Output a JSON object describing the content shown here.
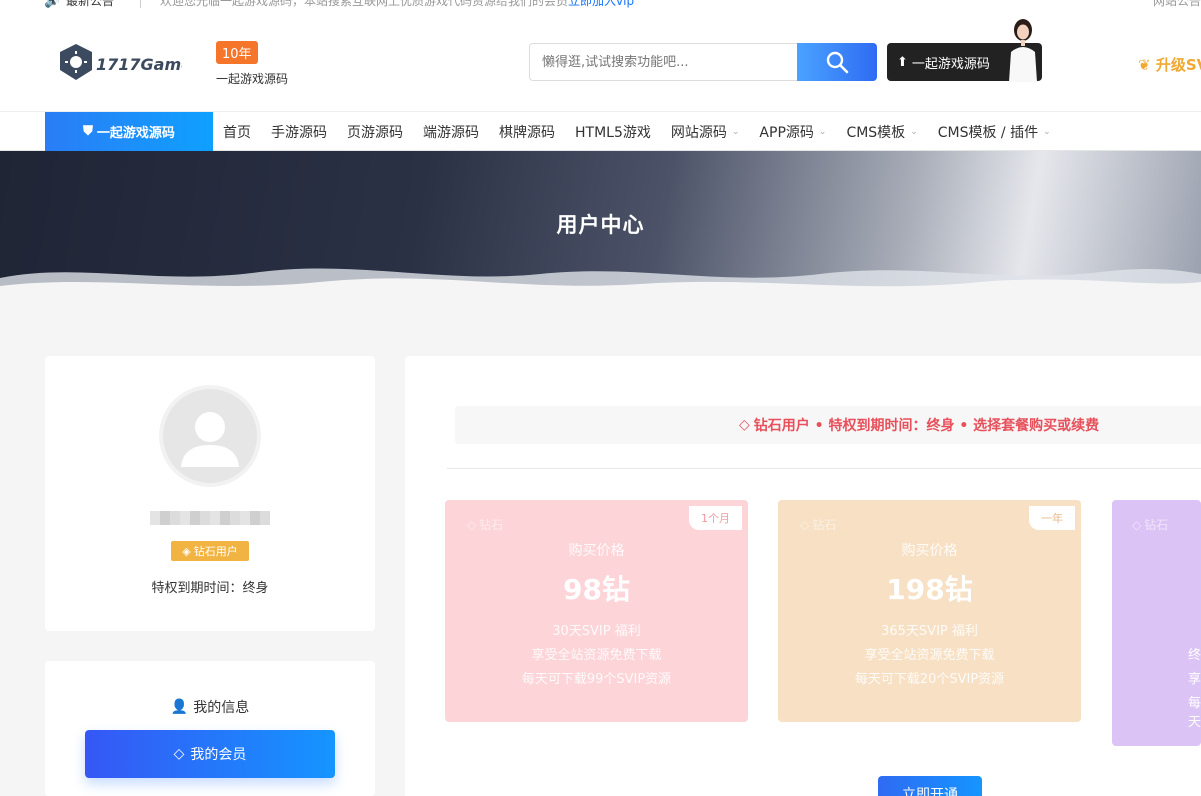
{
  "topbar": {
    "label": "最新公告",
    "message": "欢迎您光临一起游戏源码，本站搜索互联网上优质游戏代码资源给我们的会员",
    "link": "立即加入vip",
    "right": "网站公告"
  },
  "header": {
    "logo_text": "1717Game",
    "year_badge": "10年",
    "site_sub": "一起游戏源码",
    "search_placeholder": "懒得逛,试试搜索功能吧...",
    "dark_button": "一起游戏源码",
    "upgrade": "升级SVIP"
  },
  "nav": {
    "brand": "一起游戏源码",
    "items": [
      {
        "label": "首页",
        "caret": ""
      },
      {
        "label": "手游源码",
        "caret": ""
      },
      {
        "label": "页游源码",
        "caret": ""
      },
      {
        "label": "端游源码",
        "caret": ""
      },
      {
        "label": "棋牌源码",
        "caret": ""
      },
      {
        "label": "HTML5游戏",
        "caret": ""
      },
      {
        "label": "网站源码",
        "caret": "⌄"
      },
      {
        "label": "APP源码",
        "caret": "⌄"
      },
      {
        "label": "CMS模板",
        "caret": "⌄"
      },
      {
        "label": "CMS模板 / 插件",
        "caret": "⌄"
      }
    ]
  },
  "banner": {
    "title": "用户中心"
  },
  "profile": {
    "badge": "钻石用户",
    "expire": "特权到期时间：终身"
  },
  "menu": {
    "my_info": "我的信息",
    "my_vip": "我的会员"
  },
  "main": {
    "status": "钻石用户 • 特权到期时间：终身 • 选择套餐购买或续费",
    "plans": [
      {
        "corner": "钻石",
        "tag": "1个月",
        "caption": "购买价格",
        "price": "98钻",
        "line1": "30天SVIP 福利",
        "line2": "享受全站资源免费下载",
        "line3": "每天可下载99个SVIP资源"
      },
      {
        "corner": "钻石",
        "tag": "一年",
        "caption": "购买价格",
        "price": "198钻",
        "line1": "365天SVIP 福利",
        "line2": "享受全站资源免费下载",
        "line3": "每天可下载20个SVIP资源"
      },
      {
        "corner": "钻石",
        "frag1": "终",
        "frag2": "享",
        "frag3": "每天"
      }
    ],
    "buy_button": "立即开通"
  },
  "colors": {
    "accent_blue": "#1677ff",
    "status_red": "#e8505b",
    "badge_gold": "#f1b443",
    "plan1": "#fdd4d8",
    "plan2": "#f7e0c3",
    "plan3": "#dcc3f5"
  }
}
